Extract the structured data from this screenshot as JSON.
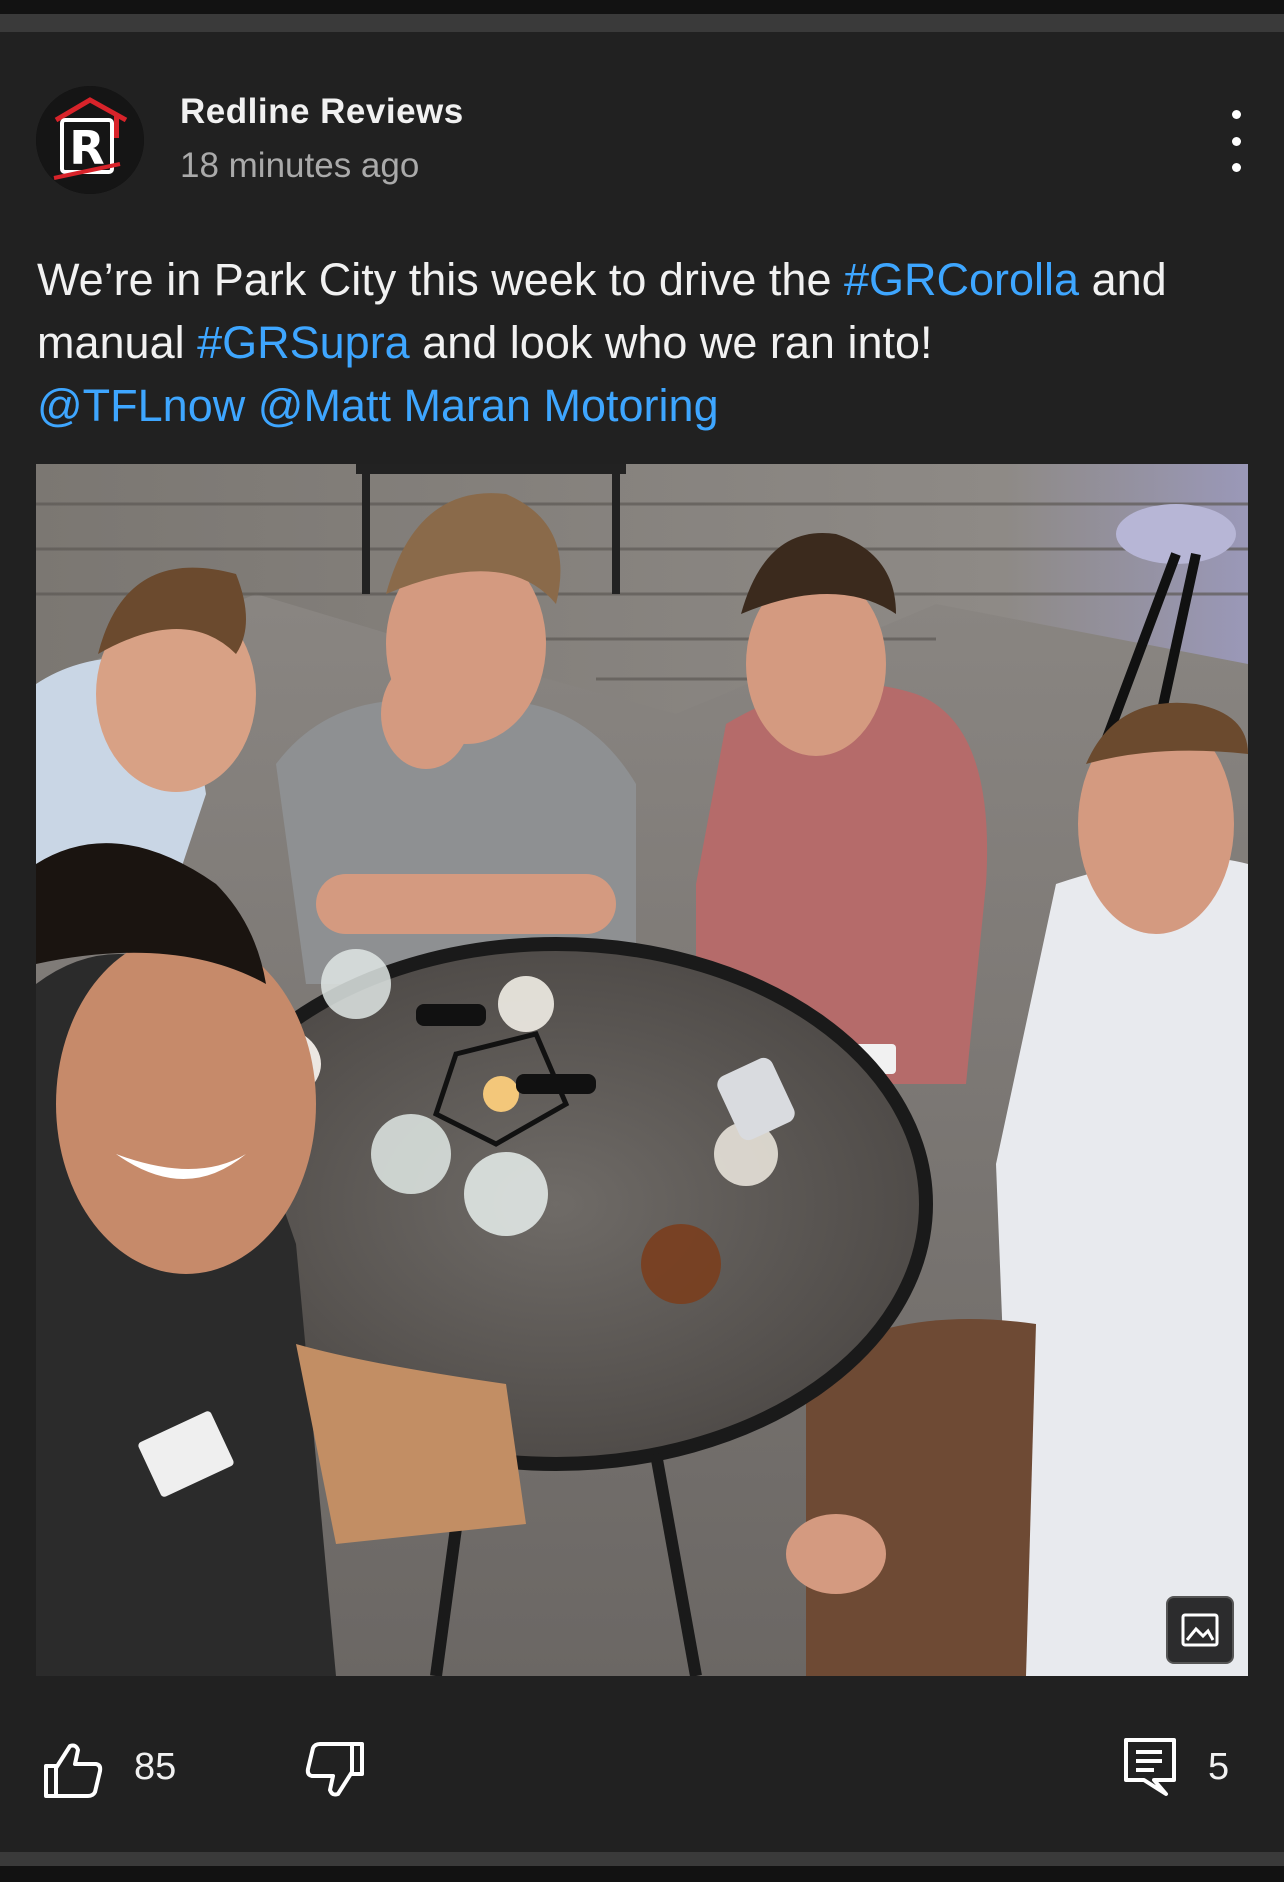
{
  "post": {
    "channel_name": "Redline Reviews",
    "time": "18 minutes ago",
    "avatar_letter": "R",
    "text": {
      "p1": "We’re in Park City this week to drive the ",
      "tag1": "#GRCorolla",
      "p2": " and manual ",
      "tag2": "#GRSupra",
      "p3": " and look who we ran into! ",
      "mention1": "@TFLnow",
      "p4": " ",
      "mention2": "@Matt Maran Motoring"
    },
    "image": {
      "description_icon": "image-icon"
    },
    "actions": {
      "likes": "85",
      "comments": "5"
    }
  },
  "icons": {
    "menu": "more-vertical-icon",
    "like": "thumbs-up-icon",
    "dislike": "thumbs-down-icon",
    "comment": "comment-icon"
  },
  "colors": {
    "background": "#212121",
    "link": "#3ea6ff",
    "text": "#f1f1f1",
    "secondary_text": "#aaaaaa",
    "brand_red": "#d8232a"
  }
}
